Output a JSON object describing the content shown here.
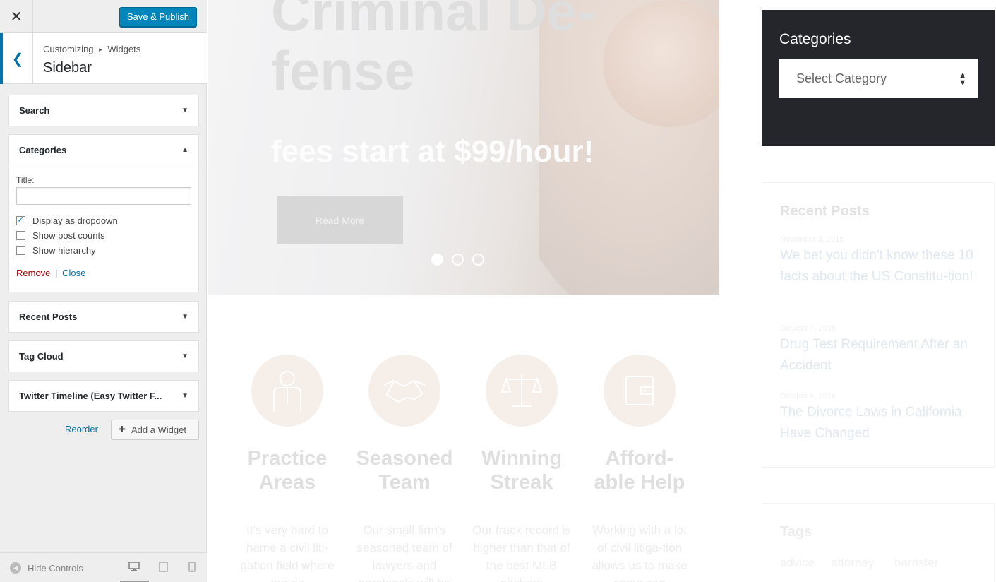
{
  "customizer": {
    "close_icon": "close-icon",
    "save_label": "Save & Publish",
    "breadcrumb": {
      "parent": "Customizing",
      "child": "Widgets"
    },
    "section_title": "Sidebar",
    "widgets": [
      {
        "label": "Search",
        "expanded": false
      },
      {
        "label": "Categories",
        "expanded": true
      },
      {
        "label": "Recent Posts",
        "expanded": false
      },
      {
        "label": "Tag Cloud",
        "expanded": false
      },
      {
        "label": "Twitter Timeline (Easy Twitter F...",
        "expanded": false
      }
    ],
    "categories_form": {
      "title_label": "Title:",
      "title_value": "",
      "options": [
        {
          "label": "Display as dropdown",
          "checked": true
        },
        {
          "label": "Show post counts",
          "checked": false
        },
        {
          "label": "Show hierarchy",
          "checked": false
        }
      ],
      "remove_label": "Remove",
      "separator": "|",
      "close_label": "Close"
    },
    "reorder_label": "Reorder",
    "add_widget_label": "Add a Widget",
    "footer": {
      "hide_controls_label": "Hide Controls",
      "devices": [
        "desktop-icon",
        "tablet-icon",
        "mobile-icon"
      ],
      "active_device": "desktop"
    }
  },
  "preview": {
    "hero": {
      "title": "Criminal De-fense",
      "subtitle": "fees start at $99/hour!",
      "button_label": "Read More",
      "slides": 3,
      "active_slide": 1
    },
    "features": [
      {
        "icon": "person-icon",
        "title": "Practice Areas",
        "text": "It's very hard to name a civil liti-gation field where our ex"
      },
      {
        "icon": "handshake-icon",
        "title": "Seasoned Team",
        "text": "Our small firm's seasoned team of lawyers and paralegals will be"
      },
      {
        "icon": "scales-icon",
        "title": "Winning Streak",
        "text": "Our track record is higher than that of the best MLB pitchers"
      },
      {
        "icon": "wallet-icon",
        "title": "Afford-able Help",
        "text": "Working with a lot of civil litiga-tion allows us to make some con"
      }
    ],
    "categories_widget": {
      "title": "Categories",
      "select_value": "Select Category"
    },
    "recent_posts": {
      "title": "Recent Posts",
      "posts": [
        {
          "date": "November 3, 2016",
          "title": "We bet you didn't know these 10 facts about the US Constitu-tion!"
        },
        {
          "date": "October 7, 2016",
          "title": "Drug Test Requirement After an Accident"
        },
        {
          "date": "October 6, 2016",
          "title": "The Divorce Laws in California Have Changed"
        }
      ]
    },
    "tags": {
      "title": "Tags",
      "items": [
        "advice",
        "attorney",
        "barrister"
      ]
    }
  }
}
